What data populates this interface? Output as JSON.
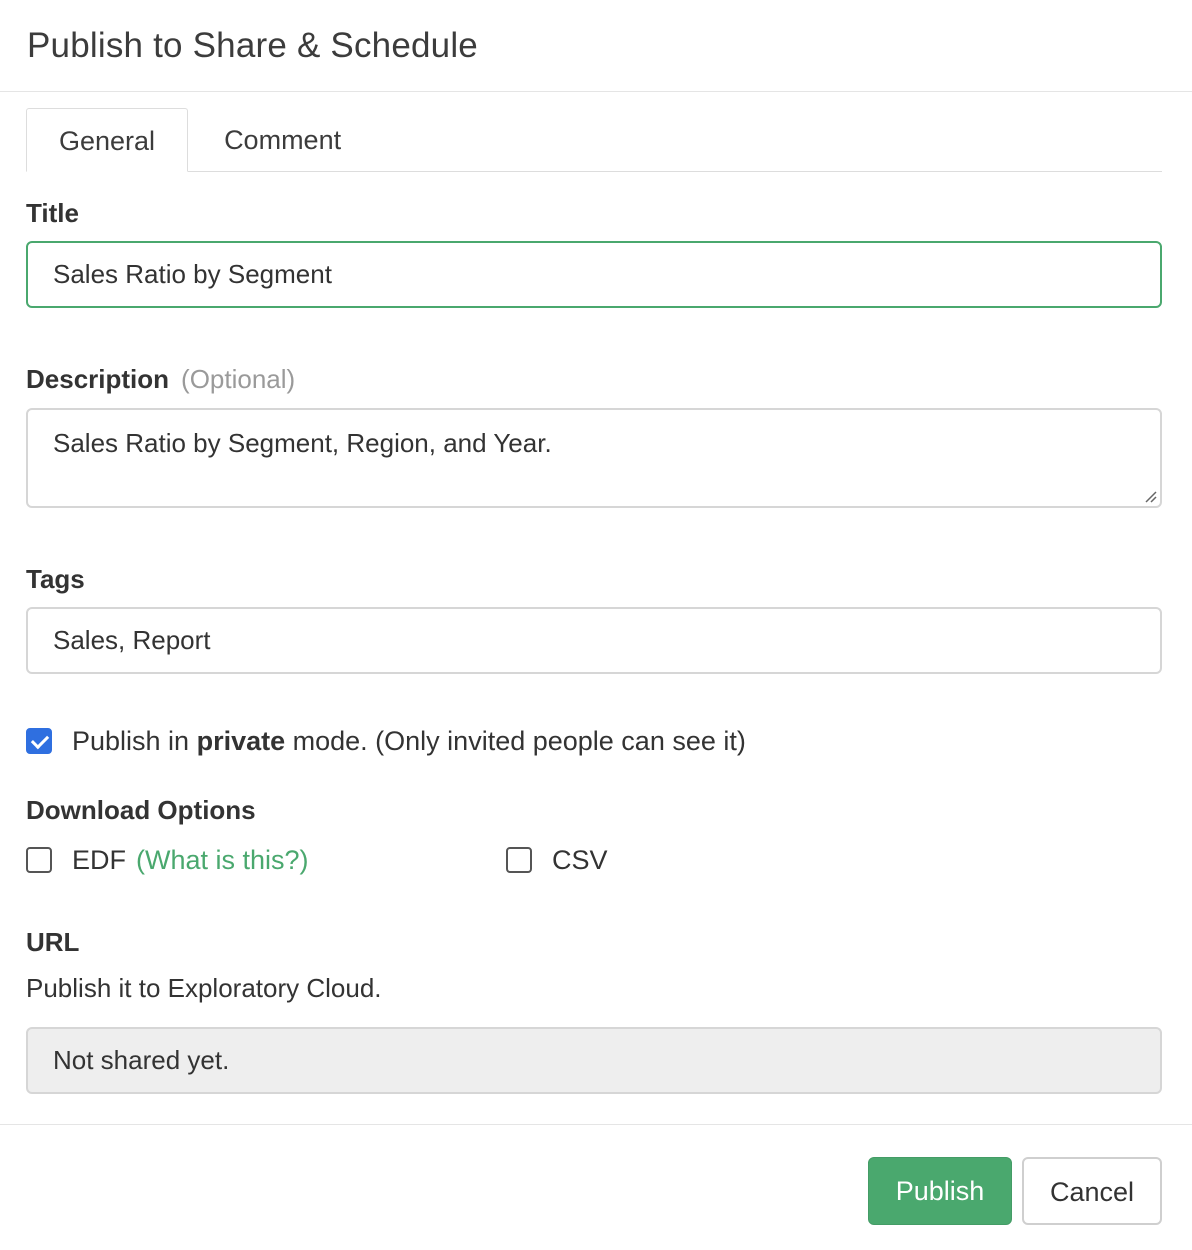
{
  "dialog": {
    "title": "Publish to Share & Schedule"
  },
  "tabs": [
    {
      "label": "General",
      "active": true
    },
    {
      "label": "Comment",
      "active": false
    }
  ],
  "form": {
    "title_label": "Title",
    "title_value": "Sales Ratio by Segment",
    "description_label": "Description",
    "description_optional": "(Optional)",
    "description_value": "Sales Ratio by Segment, Region, and Year.",
    "tags_label": "Tags",
    "tags_value": "Sales, Report",
    "private": {
      "checked": true,
      "text_before": "Publish in ",
      "text_bold": "private",
      "text_after": " mode. (Only invited people can see it)"
    },
    "download_label": "Download Options",
    "edf_label": "EDF",
    "edf_link": "(What is this?)",
    "edf_checked": false,
    "csv_label": "CSV",
    "csv_checked": false,
    "url_label": "URL",
    "url_help": "Publish it to Exploratory Cloud.",
    "url_value": "Not shared yet."
  },
  "footer": {
    "publish_label": "Publish",
    "cancel_label": "Cancel"
  },
  "colors": {
    "accent": "#4aa86e",
    "checkbox": "#2f6fe0"
  }
}
